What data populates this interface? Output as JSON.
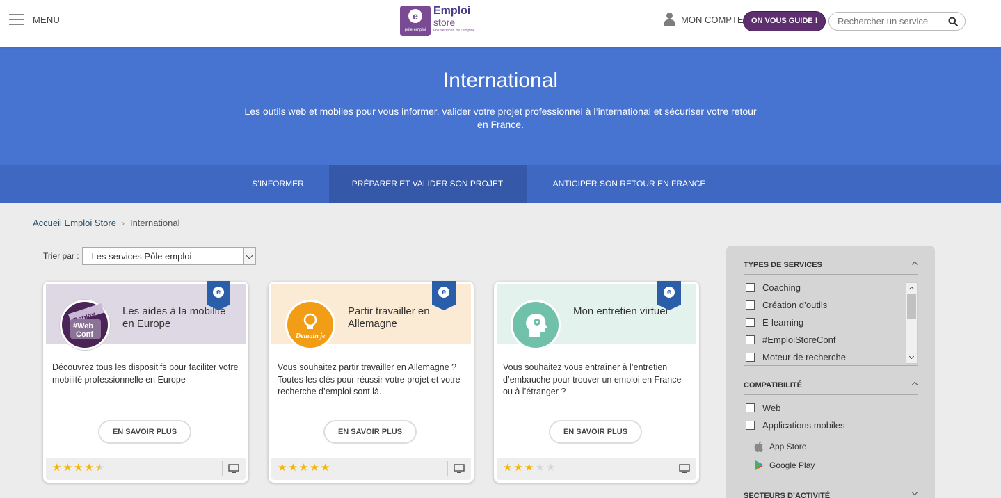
{
  "header": {
    "menu_label": "MENU",
    "logo": {
      "brand": "Emploi",
      "product": "store",
      "tagline": "vos services de l'emploi",
      "badge": "pôle emploi"
    },
    "account_label": "MON COMPTE",
    "guide_label": "ON VOUS GUIDE !",
    "search_placeholder": "Rechercher un service"
  },
  "hero": {
    "title": "International",
    "subtitle": "Les outils web et mobiles pour vous informer, valider votre projet professionnel à l’international et sécuriser votre retour en France."
  },
  "tabs": [
    {
      "label": "S’INFORMER"
    },
    {
      "label": "PRÉPARER ET VALIDER SON PROJET"
    },
    {
      "label": "ANTICIPER SON RETOUR EN FRANCE"
    }
  ],
  "breadcrumb": {
    "home": "Accueil Emploi Store",
    "current": "International"
  },
  "sort": {
    "label": "Trier par :",
    "value": "Les services Pôle emploi"
  },
  "cards": [
    {
      "title": "Les aides à la mobilité en Europe",
      "description": "Découvrez tous les dispositifs pour faciliter votre mobilité professionnelle en Europe",
      "button": "EN SAVOIR PLUS",
      "rating": 4.5,
      "icon_text": "Replay #Web Conf"
    },
    {
      "title": "Partir travailler en Allemagne",
      "description": "Vous souhaitez partir travailler en Allemagne ? Toutes les clés pour réussir votre projet et votre recherche d’emploi sont là.",
      "button": "EN SAVOIR PLUS",
      "rating": 5,
      "icon_text": "Demain je"
    },
    {
      "title": "Mon entretien virtuel",
      "description": "Vous souhaitez vous entraîner à l’entretien d’embauche pour trouver un emploi en France ou à l’étranger ?",
      "button": "EN SAVOIR PLUS",
      "rating": 3,
      "icon_text": ""
    }
  ],
  "filters": {
    "types": {
      "title": "TYPES DE SERVICES",
      "items": [
        "Coaching",
        "Création d’outils",
        "E-learning",
        "#EmploiStoreConf",
        "Moteur de recherche"
      ]
    },
    "compat": {
      "title": "COMPATIBILITÉ",
      "items": [
        "Web",
        "Applications mobiles"
      ],
      "stores": [
        "App Store",
        "Google Play"
      ]
    },
    "sectors": {
      "title": "SECTEURS D’ACTIVITÉ"
    }
  },
  "colors": {
    "hero": "#4874d1",
    "tabs": "#3f68c3",
    "brand_purple": "#5e2f6f",
    "ribbon": "#2b5ea8",
    "star": "#f4b400"
  }
}
